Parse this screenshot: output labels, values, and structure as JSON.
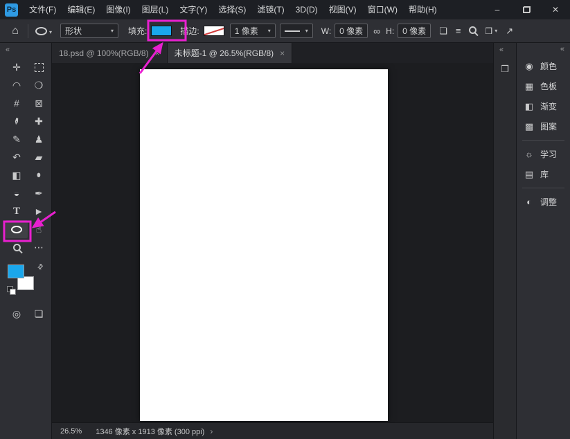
{
  "colors": {
    "accent_blue": "#1aa7ec",
    "highlight_magenta": "#e820cf"
  },
  "icons": {
    "home": "⌂",
    "caret": "▾",
    "link": "∞",
    "path_ops": "❏",
    "path_align": "≡",
    "panel_toggle": "❒",
    "share": "↗",
    "collapse": "«",
    "chevron": "›",
    "dock_panel": "❒",
    "minimize": "–",
    "close": "✕",
    "tab_close": "×",
    "swap": "⇄"
  },
  "titlebar": {
    "logo_text": "Ps",
    "menus": [
      "文件(F)",
      "编辑(E)",
      "图像(I)",
      "图层(L)",
      "文字(Y)",
      "选择(S)",
      "滤镜(T)",
      "3D(D)",
      "视图(V)",
      "窗口(W)",
      "帮助(H)"
    ]
  },
  "options_bar": {
    "preset_value": "形状",
    "fill_label": "填充:",
    "stroke_label": "描边:",
    "stroke_width_value": "1 像素",
    "w_label": "W:",
    "w_value": "0 像素",
    "h_label": "H:",
    "h_value": "0 像素"
  },
  "tabs": [
    {
      "label": "18.psd @ 100%(RGB/8)",
      "active": false
    },
    {
      "label": "未标题-1 @ 26.5%(RGB/8)",
      "active": true
    }
  ],
  "toolbar": {
    "tools": [
      {
        "name": "move-tool",
        "glyph": "✛"
      },
      {
        "name": "rectangular-marquee-tool",
        "type": "dashed"
      },
      {
        "name": "lasso-tool",
        "glyph": "◠"
      },
      {
        "name": "object-selection-tool",
        "glyph": "❍"
      },
      {
        "name": "crop-tool",
        "glyph": "#"
      },
      {
        "name": "frame-tool",
        "glyph": "⊠"
      },
      {
        "name": "eyedropper-tool",
        "glyph": "✒",
        "type": "rot"
      },
      {
        "name": "spot-healing-brush-tool",
        "glyph": "✚"
      },
      {
        "name": "brush-tool",
        "glyph": "✎"
      },
      {
        "name": "clone-stamp-tool",
        "glyph": "♟"
      },
      {
        "name": "history-brush-tool",
        "glyph": "↶"
      },
      {
        "name": "eraser-tool",
        "glyph": "▰"
      },
      {
        "name": "gradient-tool",
        "glyph": "◧"
      },
      {
        "name": "blur-tool",
        "glyph": "●",
        "type": "drop"
      },
      {
        "name": "dodge-tool",
        "glyph": "◒"
      },
      {
        "name": "pen-tool",
        "glyph": "✒"
      },
      {
        "name": "type-tool",
        "glyph": "T"
      },
      {
        "name": "path-selection-tool",
        "glyph": "►"
      },
      {
        "name": "ellipse-tool",
        "type": "oval",
        "highlighted": true
      },
      {
        "name": "hand-tool",
        "glyph": "☝"
      },
      {
        "name": "zoom-tool",
        "type": "magnifier"
      },
      {
        "name": "edit-toolbar-button",
        "glyph": "⋯"
      }
    ],
    "bottom_tools": [
      {
        "name": "quick-mask-mode-button",
        "glyph": "◎"
      },
      {
        "name": "screen-mode-button",
        "glyph": "❏"
      }
    ]
  },
  "right_panel": {
    "groups": [
      {
        "items": [
          {
            "id": "color",
            "label": "颜色",
            "glyph": "◉"
          },
          {
            "id": "swatches",
            "label": "色板",
            "glyph": "▦"
          },
          {
            "id": "gradients",
            "label": "渐变",
            "glyph": "◧"
          },
          {
            "id": "patterns",
            "label": "图案",
            "glyph": "▩"
          }
        ]
      },
      {
        "items": [
          {
            "id": "learn",
            "label": "学习",
            "glyph": "☼"
          },
          {
            "id": "libraries",
            "label": "库",
            "glyph": "▤"
          }
        ]
      },
      {
        "items": [
          {
            "id": "adjustments",
            "label": "调整",
            "glyph": "◐"
          }
        ]
      }
    ]
  },
  "statusbar": {
    "zoom": "26.5%",
    "doc_info": "1346 像素 x 1913 像素 (300 ppi)"
  }
}
